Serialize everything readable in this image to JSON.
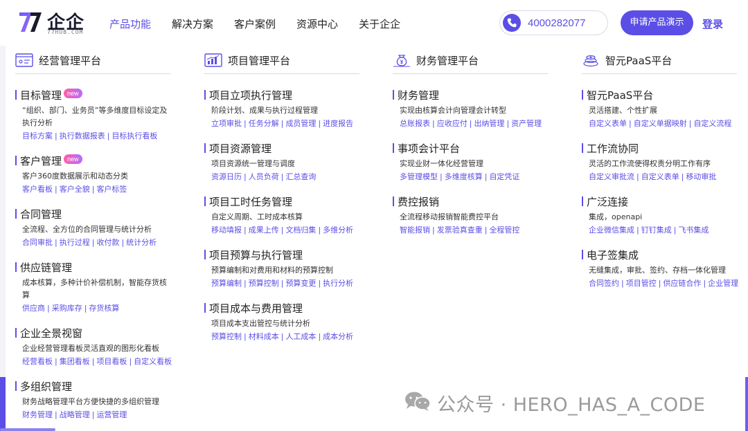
{
  "header": {
    "logo": {
      "name": "企企",
      "sub": "77HUB.COM"
    },
    "nav": [
      "产品功能",
      "解决方案",
      "客户案例",
      "资源中心",
      "关于企企"
    ],
    "active_nav": 0,
    "phone": "4000282077",
    "demo_button": "申请产品演示",
    "login": "登录",
    "accent_color": "#5b4ee6"
  },
  "columns": [
    {
      "title": "经营管理平台",
      "icon": "dashboard-icon",
      "items": [
        {
          "title": "目标管理",
          "badge": "new",
          "desc": "“组织、部门、业务员”等多维度目标设定及执行分析",
          "links": [
            "目标方案",
            "执行数据报表",
            "目标执行看板"
          ]
        },
        {
          "title": "客户管理",
          "badge": "new",
          "desc": "客户360度数据展示和动态分类",
          "links": [
            "客户看板",
            "客户全貌",
            "客户标签"
          ]
        },
        {
          "title": "合同管理",
          "badge": "",
          "desc": "全流程、全方位的合同管理与统计分析",
          "links": [
            "合同审批",
            "执行过程",
            "收付款",
            "统计分析"
          ]
        },
        {
          "title": "供应链管理",
          "badge": "",
          "desc": "成本核算，多种计价补偿机制，智能存货核算",
          "links": [
            "供应商",
            "采购库存",
            "存货核算"
          ]
        },
        {
          "title": "企业全景视窗",
          "badge": "",
          "desc": "企业经营管理看板灵活直观的图形化看板",
          "links": [
            "经营看板",
            "集团看板",
            "项目看板",
            "自定义看板"
          ]
        },
        {
          "title": "多组织管理",
          "badge": "",
          "desc": "财务战略管理平台方便快捷的多组织管理",
          "links": [
            "财务管理",
            "战略管理",
            "运营管理"
          ]
        }
      ]
    },
    {
      "title": "项目管理平台",
      "icon": "chart-board-icon",
      "items": [
        {
          "title": "项目立项执行管理",
          "desc": "阶段计划、成果与执行过程管理",
          "links": [
            "立项审批",
            "任务分解",
            "成员管理",
            "进度报告"
          ]
        },
        {
          "title": "项目资源管理",
          "desc": "项目资源统一管理与调度",
          "links": [
            "资源日历",
            "人员负荷",
            "汇总查询"
          ]
        },
        {
          "title": "项目工时任务管理",
          "desc": "自定义周期、工时成本核算",
          "links": [
            "移动填报",
            "成果上传",
            "文档归集",
            "多维分析"
          ]
        },
        {
          "title": "项目预算与执行管理",
          "desc": "预算编制和对费用和材料的预算控制",
          "links": [
            "预算编制",
            "预算控制",
            "预算变更",
            "执行分析"
          ]
        },
        {
          "title": "项目成本与费用管理",
          "desc": "项目成本支出管控与统计分析",
          "links": [
            "预算控制",
            "材料成本",
            "人工成本",
            "成本分析"
          ]
        }
      ]
    },
    {
      "title": "财务管理平台",
      "icon": "money-bag-icon",
      "items": [
        {
          "title": "财务管理",
          "desc": "实现由核算会计向管理会计转型",
          "links": [
            "总账报表",
            "应收应付",
            "出纳管理",
            "资产管理"
          ]
        },
        {
          "title": "事项会计平台",
          "desc": "实现业财一体化经营管理",
          "links": [
            "多管理模型",
            "多维度核算",
            "自定凭证"
          ]
        },
        {
          "title": "费控报销",
          "desc": "全流程移动报销智能费控平台",
          "links": [
            "智能报销",
            "发票验真查重",
            "全程管控"
          ]
        }
      ]
    },
    {
      "title": "智元PaaS平台",
      "icon": "layers-icon",
      "items": [
        {
          "title": "智元PaaS平台",
          "desc": "灵活搭建、个性扩展",
          "links": [
            "自定义表单",
            "自定义单据映射",
            "自定义流程"
          ]
        },
        {
          "title": "工作流协同",
          "desc": "灵活的工作流使得权责分明工作有序",
          "links": [
            "自定义审批流",
            "自定义表单",
            "移动审批"
          ]
        },
        {
          "title": "广泛连接",
          "desc": "集成，openapi",
          "links": [
            "企业微信集成",
            "钉钉集成",
            "飞书集成"
          ]
        },
        {
          "title": "电子签集成",
          "desc": "无缝集成，审批、签约、存档一体化管理",
          "links": [
            "合同签约",
            "项目管控",
            "供应链合作",
            "企业管理"
          ]
        }
      ]
    }
  ],
  "watermark": "公众号 · HERO_HAS_A_CODE"
}
